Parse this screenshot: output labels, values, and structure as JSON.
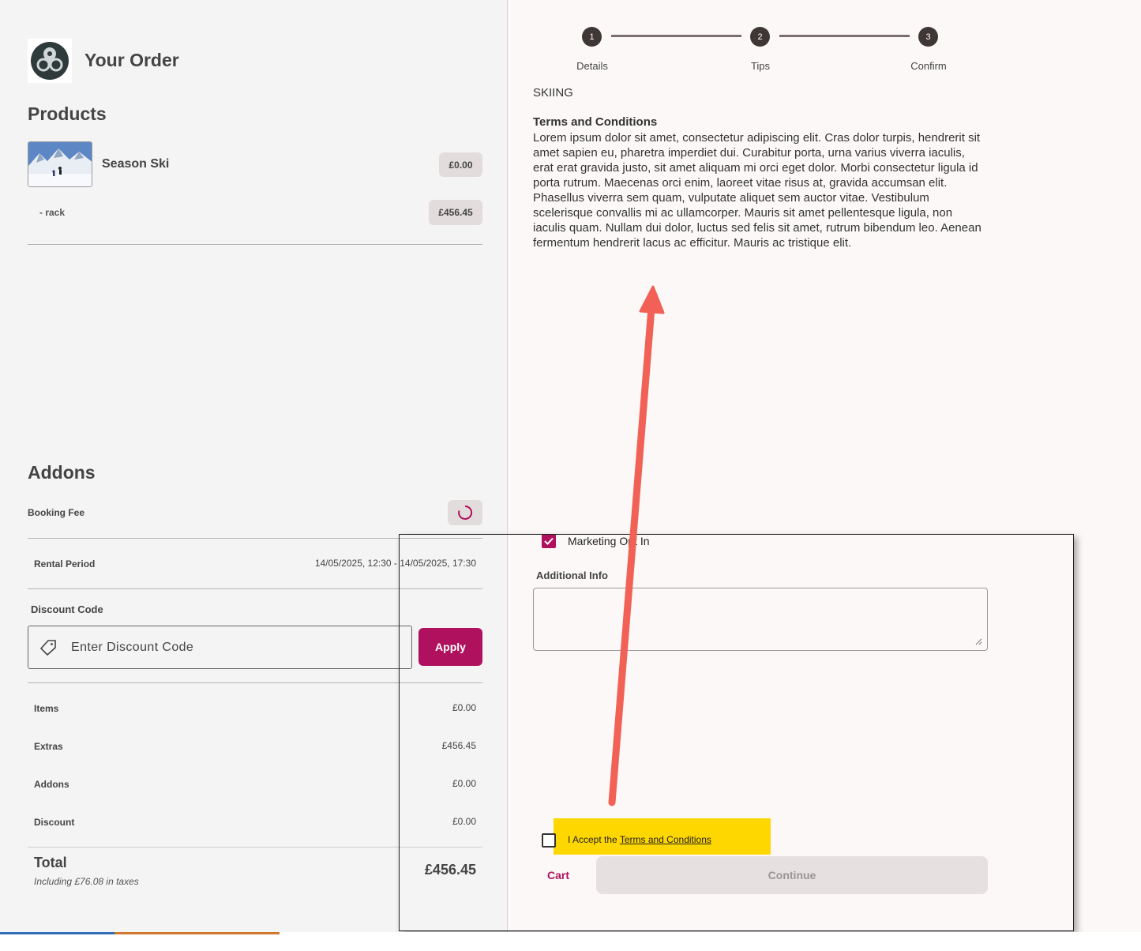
{
  "order": {
    "title": "Your Order",
    "products_heading": "Products",
    "product": {
      "name": "Season Ski",
      "price": "£0.00"
    },
    "extra": {
      "name": "- rack",
      "price": "£456.45"
    },
    "addons_heading": "Addons",
    "booking_fee_label": "Booking Fee",
    "rental_period_label": "Rental Period",
    "rental_period_value": "14/05/2025, 12:30 - 14/05/2025, 17:30",
    "discount_label": "Discount Code",
    "discount_placeholder": "Enter Discount Code",
    "apply_label": "Apply",
    "summary": [
      {
        "label": "Items",
        "value": "£0.00"
      },
      {
        "label": "Extras",
        "value": "£456.45"
      },
      {
        "label": "Addons",
        "value": "£0.00"
      },
      {
        "label": "Discount",
        "value": "£0.00"
      }
    ],
    "total_label": "Total",
    "tax_note": "Including £76.08 in taxes",
    "total_value": "£456.45"
  },
  "stepper": {
    "steps": [
      {
        "number": "1",
        "label": "Details"
      },
      {
        "number": "2",
        "label": "Tips"
      },
      {
        "number": "3",
        "label": "Confirm"
      }
    ],
    "current_step": 3
  },
  "details": {
    "activity": "SKIING",
    "terms_title": "Terms and Conditions",
    "terms_body": "Lorem ipsum dolor sit amet, consectetur adipiscing elit. Cras dolor turpis, hendrerit sit amet sapien eu, pharetra imperdiet dui. Curabitur porta, urna varius viverra iaculis, erat erat gravida justo, sit amet aliquam mi orci eget dolor. Morbi consectetur ligula id porta rutrum. Maecenas orci enim, laoreet vitae risus at, gravida accumsan elit. Phasellus viverra sem quam, vulputate aliquet sem auctor vitae. Vestibulum scelerisque convallis mi ac ullamcorper. Mauris sit amet pellentesque ligula, non iaculis quam. Nullam dui dolor, luctus sed felis sit amet, rutrum bibendum leo. Aenean fermentum hendrerit lacus ac efficitur. Mauris ac tristique elit.",
    "marketing_label": "Marketing Opt In",
    "marketing_checked": true,
    "additional_info_label": "Additional Info",
    "additional_info_value": "",
    "accept_prefix": "I Accept the ",
    "accept_link": "Terms and Conditions",
    "accept_checked": false,
    "cart_label": "Cart",
    "continue_label": "Continue"
  },
  "colors": {
    "accent": "#b0115e",
    "highlight": "#ffd700",
    "annotation_arrow": "#f26155"
  }
}
